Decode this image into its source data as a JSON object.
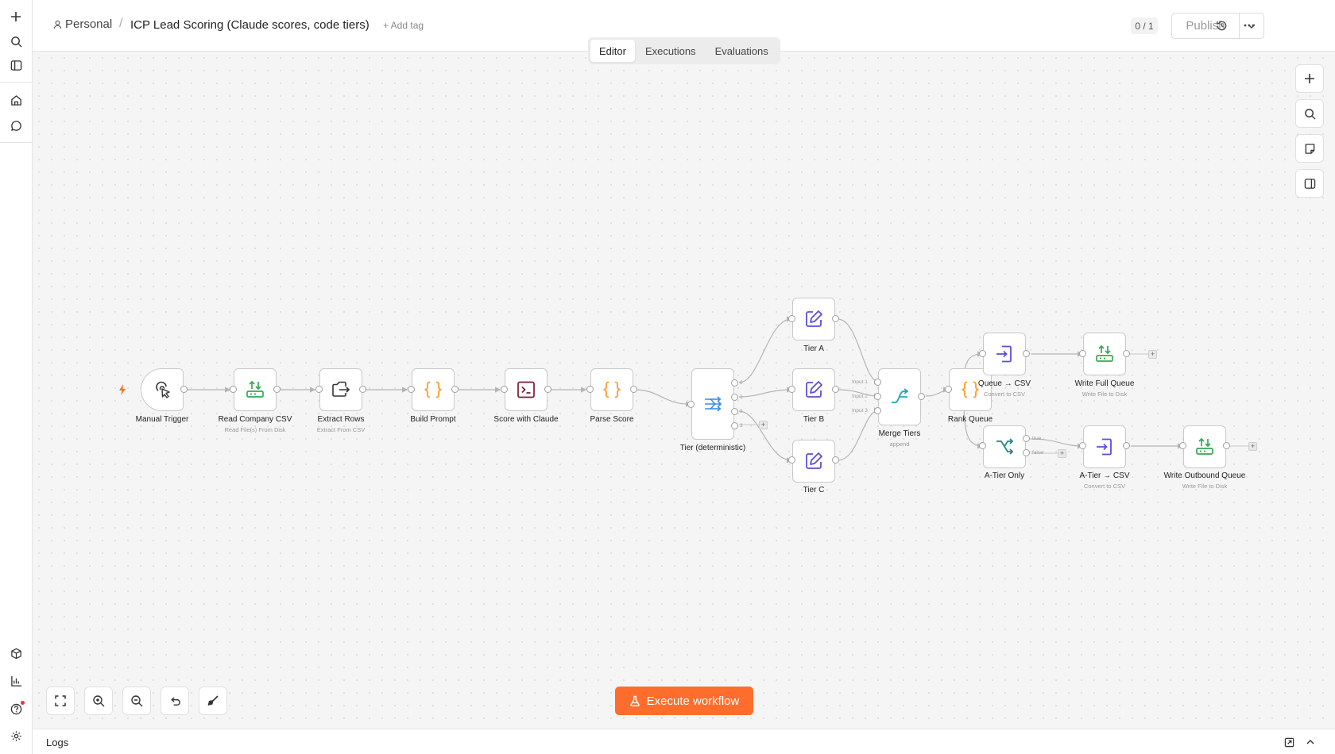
{
  "header": {
    "breadcrumb_project": "Personal",
    "workflow_title": "ICP Lead Scoring (Claude scores, code tiers)",
    "add_tag": "+ Add tag",
    "counter": "0 / 1",
    "publish_label": "Publish"
  },
  "tabs": [
    {
      "label": "Editor",
      "active": true
    },
    {
      "label": "Executions",
      "active": false
    },
    {
      "label": "Evaluations",
      "active": false
    }
  ],
  "nodes": {
    "manual_trigger": {
      "label": "Manual Trigger",
      "sub": "",
      "icon": "pointer-click-icon"
    },
    "read_company_csv": {
      "label": "Read Company CSV",
      "sub": "Read File(s) From Disk",
      "icon": "file-transfer-icon"
    },
    "extract_rows": {
      "label": "Extract Rows",
      "sub": "Extract From CSV",
      "icon": "file-export-icon"
    },
    "build_prompt": {
      "label": "Build Prompt",
      "sub": "",
      "icon": "code-braces-icon"
    },
    "score_with_claude": {
      "label": "Score with Claude",
      "sub": "",
      "icon": "terminal-icon"
    },
    "parse_score": {
      "label": "Parse Score",
      "sub": "",
      "icon": "code-braces-icon"
    },
    "tier": {
      "label": "Tier (deterministic)",
      "sub": "",
      "icon": "switch-icon",
      "outputs": [
        "0",
        "1",
        "2",
        "3"
      ]
    },
    "tier_a": {
      "label": "Tier A",
      "sub": "",
      "icon": "edit-icon"
    },
    "tier_b": {
      "label": "Tier B",
      "sub": "",
      "icon": "edit-icon"
    },
    "tier_c": {
      "label": "Tier C",
      "sub": "",
      "icon": "edit-icon"
    },
    "merge_tiers": {
      "label": "Merge Tiers",
      "sub": "append",
      "icon": "merge-icon",
      "inputs": [
        "Input 1",
        "Input 2",
        "Input 3"
      ]
    },
    "rank_queue": {
      "label": "Rank Queue",
      "sub": "",
      "icon": "code-braces-icon"
    },
    "queue_csv": {
      "label": "Queue → CSV",
      "sub": "Convert to CSV",
      "icon": "file-import-icon"
    },
    "write_full_queue": {
      "label": "Write Full Queue",
      "sub": "Write File to Disk",
      "icon": "file-transfer-icon"
    },
    "a_tier_only": {
      "label": "A-Tier Only",
      "sub": "",
      "icon": "if-branch-icon",
      "outputs": [
        "true",
        "false"
      ]
    },
    "a_tier_csv": {
      "label": "A-Tier → CSV",
      "sub": "Convert to CSV",
      "icon": "file-import-icon"
    },
    "write_outbound_queue": {
      "label": "Write Outbound Queue",
      "sub": "Write File to Disk",
      "icon": "file-transfer-icon"
    }
  },
  "execute_label": "Execute workflow",
  "logs_label": "Logs",
  "colors": {
    "accent": "#ff6d2c",
    "green": "#35a853",
    "purple": "#5b4fd6",
    "orange": "#ff9b26",
    "maroon": "#7a1c33",
    "blue": "#3a8ee6",
    "teal": "#1f8a83"
  }
}
